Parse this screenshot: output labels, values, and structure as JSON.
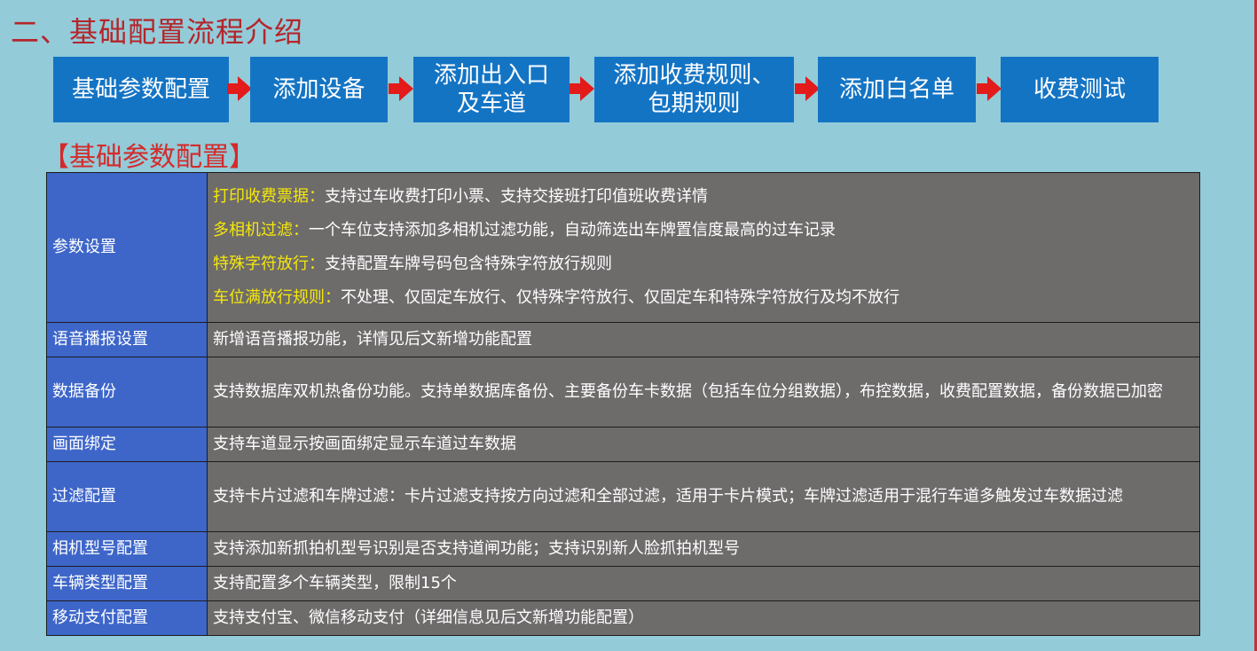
{
  "page": {
    "title": "二、基础配置流程介绍",
    "colors": {
      "background": "#93cbd9",
      "title_red": "#b5252a",
      "step_blue": "#1474c4",
      "arrow_red": "#e31b1b",
      "label_blue": "#3e66c9",
      "content_gray": "#6e6b6b",
      "highlight_yellow": "#f4e80a"
    }
  },
  "flow": {
    "steps": [
      "基础参数配置",
      "添加设备",
      "添加出入口\n及车道",
      "添加收费规则、\n包期规则",
      "添加白名单",
      "收费测试"
    ],
    "connector_icon": "right-arrow-icon"
  },
  "section": {
    "heading": "【基础参数配置】"
  },
  "table": {
    "rows": [
      {
        "label": "参数设置",
        "lines": [
          {
            "key": "打印收费票据：",
            "text": "支持过车收费打印小票、支持交接班打印值班收费详情"
          },
          {
            "key": "多相机过滤：",
            "text": "一个车位支持添加多相机过滤功能，自动筛选出车牌置信度最高的过车记录"
          },
          {
            "key": "特殊字符放行：",
            "text": "支持配置车牌号码包含特殊字符放行规则"
          },
          {
            "key": "车位满放行规则：",
            "text": "不处理、仅固定车放行、仅特殊字符放行、仅固定车和特殊字符放行及均不放行"
          }
        ]
      },
      {
        "label": "语音播报设置",
        "text": "新增语音播报功能，详情见后文新增功能配置"
      },
      {
        "label": "数据备份",
        "text": "支持数据库双机热备份功能。支持单数据库备份、主要备份车卡数据（包括车位分组数据），布控数据，收费配置数据，备份数据已加密"
      },
      {
        "label": "画面绑定",
        "text": "支持车道显示按画面绑定显示车道过车数据"
      },
      {
        "label": "过滤配置",
        "text": "支持卡片过滤和车牌过滤：卡片过滤支持按方向过滤和全部过滤，适用于卡片模式；车牌过滤适用于混行车道多触发过车数据过滤"
      },
      {
        "label": "相机型号配置",
        "text": "支持添加新抓拍机型号识别是否支持道闸功能；支持识别新人脸抓拍机型号"
      },
      {
        "label": "车辆类型配置",
        "text": "支持配置多个车辆类型，限制15个"
      },
      {
        "label": "移动支付配置",
        "text": "支持支付宝、微信移动支付（详细信息见后文新增功能配置）"
      }
    ]
  }
}
